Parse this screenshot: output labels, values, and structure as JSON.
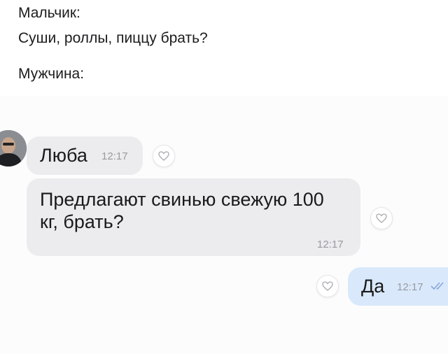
{
  "captions": {
    "boy_label": "Мальчик:",
    "boy_text": "Суши, роллы, пиццу брать?",
    "man_label": "Мужчина:"
  },
  "chat": {
    "messages": [
      {
        "author": "Люба",
        "time": "12:17",
        "icon": "heart-outline-icon"
      },
      {
        "text_line1": "Предлагают свинью свежую 100",
        "text_line2": "кг, брать?",
        "time": "12:17",
        "icon": "heart-outline-icon"
      },
      {
        "text": "Да",
        "time": "12:17",
        "status_icon": "double-check-icon",
        "icon": "heart-outline-icon"
      }
    ],
    "colors": {
      "incoming_bubble": "#ececee",
      "outgoing_bubble": "#d9e9fb",
      "check_color": "#8aa6d8"
    }
  }
}
